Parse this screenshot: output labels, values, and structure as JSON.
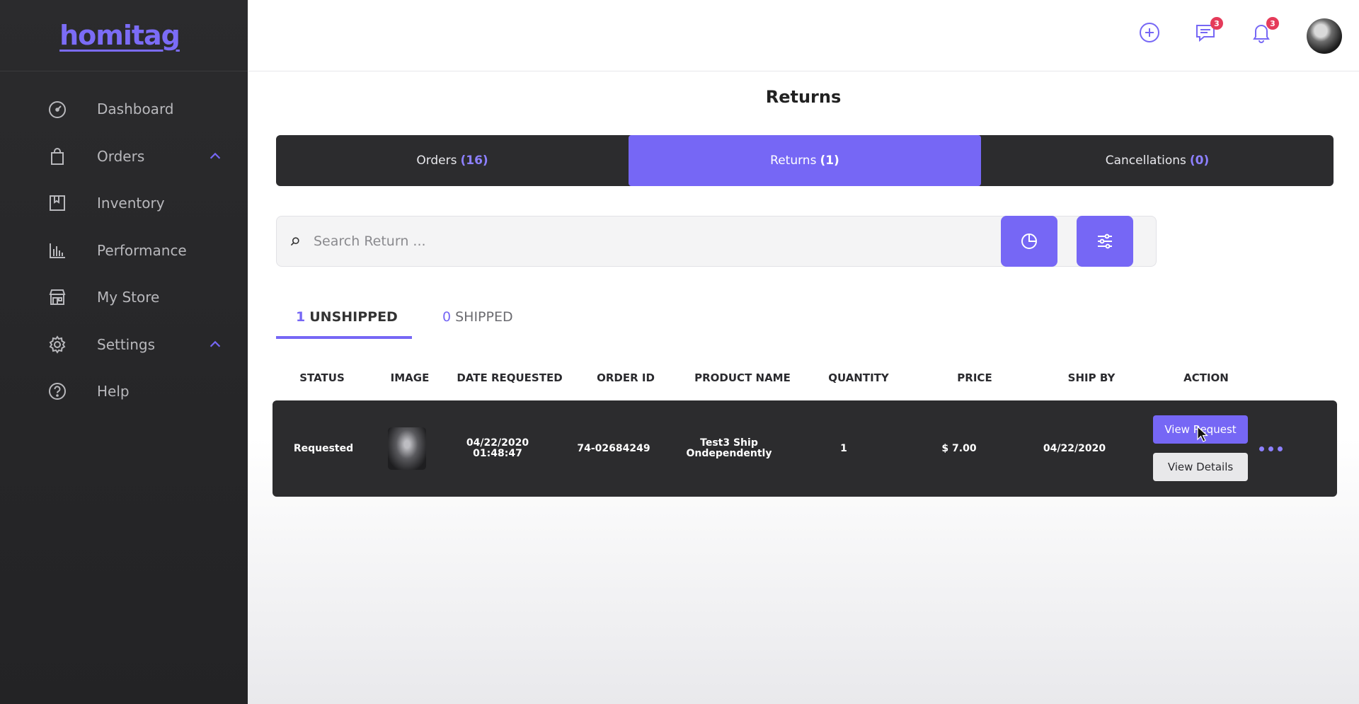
{
  "brand": {
    "logo": "homitag",
    "accent": "#7667f5"
  },
  "sidebar": {
    "items": [
      {
        "label": "Dashboard",
        "icon": "gauge-icon"
      },
      {
        "label": "Orders",
        "icon": "shopping-bag-icon",
        "expanded": true
      },
      {
        "label": "Inventory",
        "icon": "bookmark-box-icon"
      },
      {
        "label": "Performance",
        "icon": "bar-chart-icon"
      },
      {
        "label": "My Store",
        "icon": "storefront-icon"
      },
      {
        "label": "Settings",
        "icon": "gear-icon",
        "expanded": true
      },
      {
        "label": "Help",
        "icon": "question-circle-icon"
      }
    ]
  },
  "topbar": {
    "messages_badge": "3",
    "notifications_badge": "3"
  },
  "page": {
    "title": "Returns"
  },
  "segments": [
    {
      "label": "Orders",
      "count": "(16)",
      "active": false
    },
    {
      "label": "Returns",
      "count": "(1)",
      "active": true
    },
    {
      "label": "Cancellations",
      "count": "(0)",
      "active": false
    }
  ],
  "search": {
    "placeholder": "Search Return ...",
    "value": ""
  },
  "subtabs": [
    {
      "count": "1",
      "label": "UNSHIPPED",
      "active": true
    },
    {
      "count": "0",
      "label": "SHIPPED",
      "active": false
    }
  ],
  "table": {
    "headers": [
      "STATUS",
      "IMAGE",
      "DATE REQUESTED",
      "ORDER ID",
      "PRODUCT NAME",
      "QUANTITY",
      "PRICE",
      "SHIP BY",
      "ACTION"
    ],
    "rows": [
      {
        "status": "Requested",
        "date_line1": "04/22/2020",
        "date_line2": "01:48:47",
        "order_id": "74-02684249",
        "product_line1": "Test3 Ship",
        "product_line2": "Ondependently",
        "quantity": "1",
        "price": "$ 7.00",
        "ship_by": "04/22/2020",
        "view_request": "View Request",
        "view_details": "View Details"
      }
    ]
  }
}
